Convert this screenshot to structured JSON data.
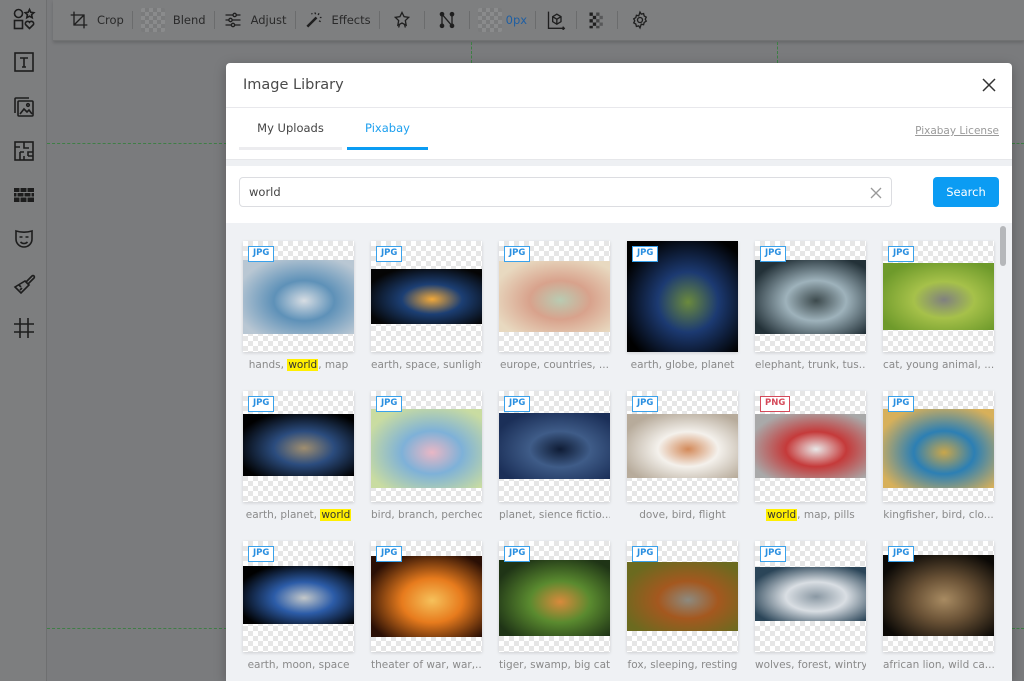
{
  "toolbar": {
    "crop_label": "Crop",
    "blend_label": "Blend",
    "adjust_label": "Adjust",
    "effects_label": "Effects",
    "border_value": "0px"
  },
  "sidebar": {
    "items": [
      {
        "name": "shapes"
      },
      {
        "name": "text"
      },
      {
        "name": "images"
      },
      {
        "name": "pattern"
      },
      {
        "name": "texture"
      },
      {
        "name": "mask"
      },
      {
        "name": "paint"
      },
      {
        "name": "grid"
      }
    ]
  },
  "modal": {
    "title": "Image Library",
    "tabs": [
      {
        "label": "My Uploads",
        "active": false
      },
      {
        "label": "Pixabay",
        "active": true
      }
    ],
    "license_link": "Pixabay License",
    "search": {
      "value": "world",
      "placeholder": "",
      "button_label": "Search"
    },
    "highlight_term": "world",
    "results": [
      {
        "format": "JPG",
        "caption": "hands, world, map",
        "colors": [
          "#b9c7d3",
          "#5e91b8",
          "#d7dde3"
        ],
        "fit": "wide"
      },
      {
        "format": "JPG",
        "caption": "earth, space, sunlight",
        "colors": [
          "#050505",
          "#1c3f74",
          "#f2a93a"
        ],
        "fit": "wide"
      },
      {
        "format": "JPG",
        "caption": "europe, countries, ...",
        "colors": [
          "#e8d9c0",
          "#d8a28c",
          "#b9cbb2"
        ],
        "fit": "wide"
      },
      {
        "format": "JPG",
        "caption": "earth, globe, planet",
        "colors": [
          "#000000",
          "#1c3a72",
          "#6b8a3d"
        ],
        "fit": "full"
      },
      {
        "format": "JPG",
        "caption": "elephant, trunk, tus...",
        "colors": [
          "#233138",
          "#9eb2bb",
          "#3d4a4d"
        ],
        "fit": "wide"
      },
      {
        "format": "JPG",
        "caption": "cat, young animal, ...",
        "colors": [
          "#6e9a2b",
          "#a6c14a",
          "#808080"
        ],
        "fit": "wide"
      },
      {
        "format": "JPG",
        "caption": "earth, planet, world",
        "colors": [
          "#000000",
          "#2b4c7e",
          "#a08e6f"
        ],
        "fit": "wide"
      },
      {
        "format": "JPG",
        "caption": "bird, branch, perched",
        "colors": [
          "#c9dca1",
          "#7eb1d8",
          "#e9b7c5"
        ],
        "fit": "wide"
      },
      {
        "format": "JPG",
        "caption": "planet, sience fictio...",
        "colors": [
          "#1b2f58",
          "#3f5c88",
          "#0f1c35"
        ],
        "fit": "wide"
      },
      {
        "format": "JPG",
        "caption": "dove, bird, flight",
        "colors": [
          "#b7ab9b",
          "#f4f1ec",
          "#d38a5a"
        ],
        "fit": "wide"
      },
      {
        "format": "PNG",
        "caption": "world, map, pills",
        "colors": [
          "#a9a9a9",
          "#c53a3a",
          "#e8e8e8"
        ],
        "fit": "wide"
      },
      {
        "format": "JPG",
        "caption": "kingfisher, bird, clo...",
        "colors": [
          "#d7b05a",
          "#2c7fb4",
          "#c9a64b"
        ],
        "fit": "wide"
      },
      {
        "format": "JPG",
        "caption": "earth, moon, space",
        "colors": [
          "#000000",
          "#2c5ca8",
          "#c4c8c9"
        ],
        "fit": "wide"
      },
      {
        "format": "JPG",
        "caption": "theater of war, war,...",
        "colors": [
          "#2a0f05",
          "#e77b1d",
          "#f6c15b"
        ],
        "fit": "wide"
      },
      {
        "format": "JPG",
        "caption": "tiger, swamp, big cat",
        "colors": [
          "#1f3416",
          "#5a8a2f",
          "#d88a3c"
        ],
        "fit": "wide"
      },
      {
        "format": "JPG",
        "caption": "fox, sleeping, resting",
        "colors": [
          "#6b6a1f",
          "#a4581f",
          "#8d8a7f"
        ],
        "fit": "wide"
      },
      {
        "format": "JPG",
        "caption": "wolves, forest, wintry",
        "colors": [
          "#2b4558",
          "#d9dee3",
          "#8a98a3"
        ],
        "fit": "wide"
      },
      {
        "format": "JPG",
        "caption": "african lion, wild ca...",
        "colors": [
          "#0b0906",
          "#6a5236",
          "#a88b62"
        ],
        "fit": "wide"
      }
    ]
  }
}
